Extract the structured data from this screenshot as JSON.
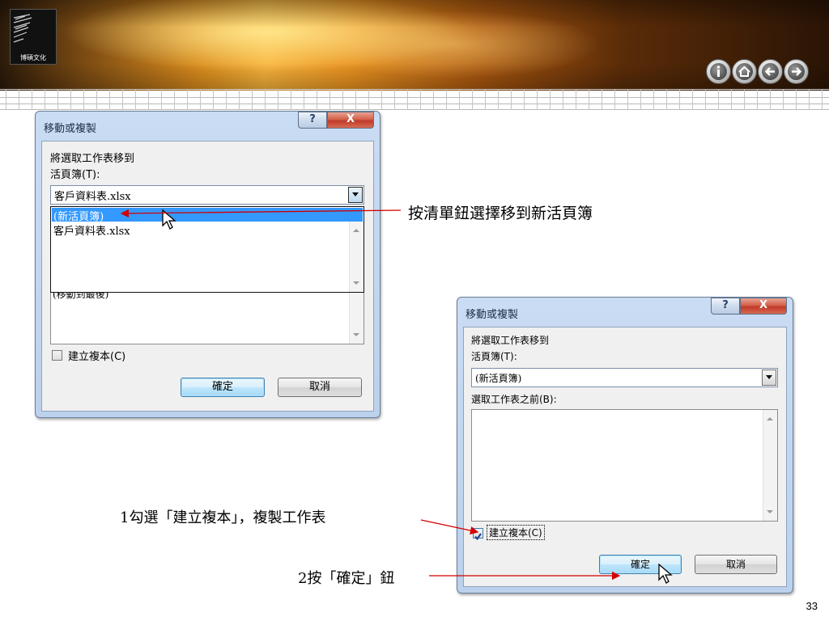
{
  "slide": {
    "logo_text": "博碩文化",
    "page_number": "33"
  },
  "nav_buttons": [
    {
      "icon": "info-icon"
    },
    {
      "icon": "home-icon"
    },
    {
      "icon": "arrow-left-icon"
    },
    {
      "icon": "arrow-right-icon"
    }
  ],
  "dialog1": {
    "title": "移動或複製",
    "help_label": "?",
    "close_label": "X",
    "move_label": "將選取工作表移到",
    "book_label": "活頁簿(T):",
    "book_value": "客戶資料表.xlsx",
    "dropdown_options": [
      "(新活頁簿)",
      "客戶資料表.xlsx"
    ],
    "hidden_list_item": "(移動到最後)",
    "copy_checkbox_label": "建立複本(C)",
    "copy_checked": false,
    "ok_label": "確定",
    "cancel_label": "取消"
  },
  "dialog2": {
    "title": "移動或複製",
    "help_label": "?",
    "close_label": "X",
    "move_label": "將選取工作表移到",
    "book_label": "活頁簿(T):",
    "book_value": "(新活頁簿)",
    "before_label": "選取工作表之前(B):",
    "copy_checkbox_label": "建立複本(C)",
    "copy_checked": true,
    "ok_label": "確定",
    "cancel_label": "取消"
  },
  "annotations": {
    "dropdown_note": "按清單鈕選擇移到新活頁簿",
    "copy_note": "1勾選「建立複本」，複製工作表",
    "ok_note": "2按「確定」鈕"
  },
  "colors": {
    "arrow": "#d20000",
    "selection": "#3399ff"
  }
}
